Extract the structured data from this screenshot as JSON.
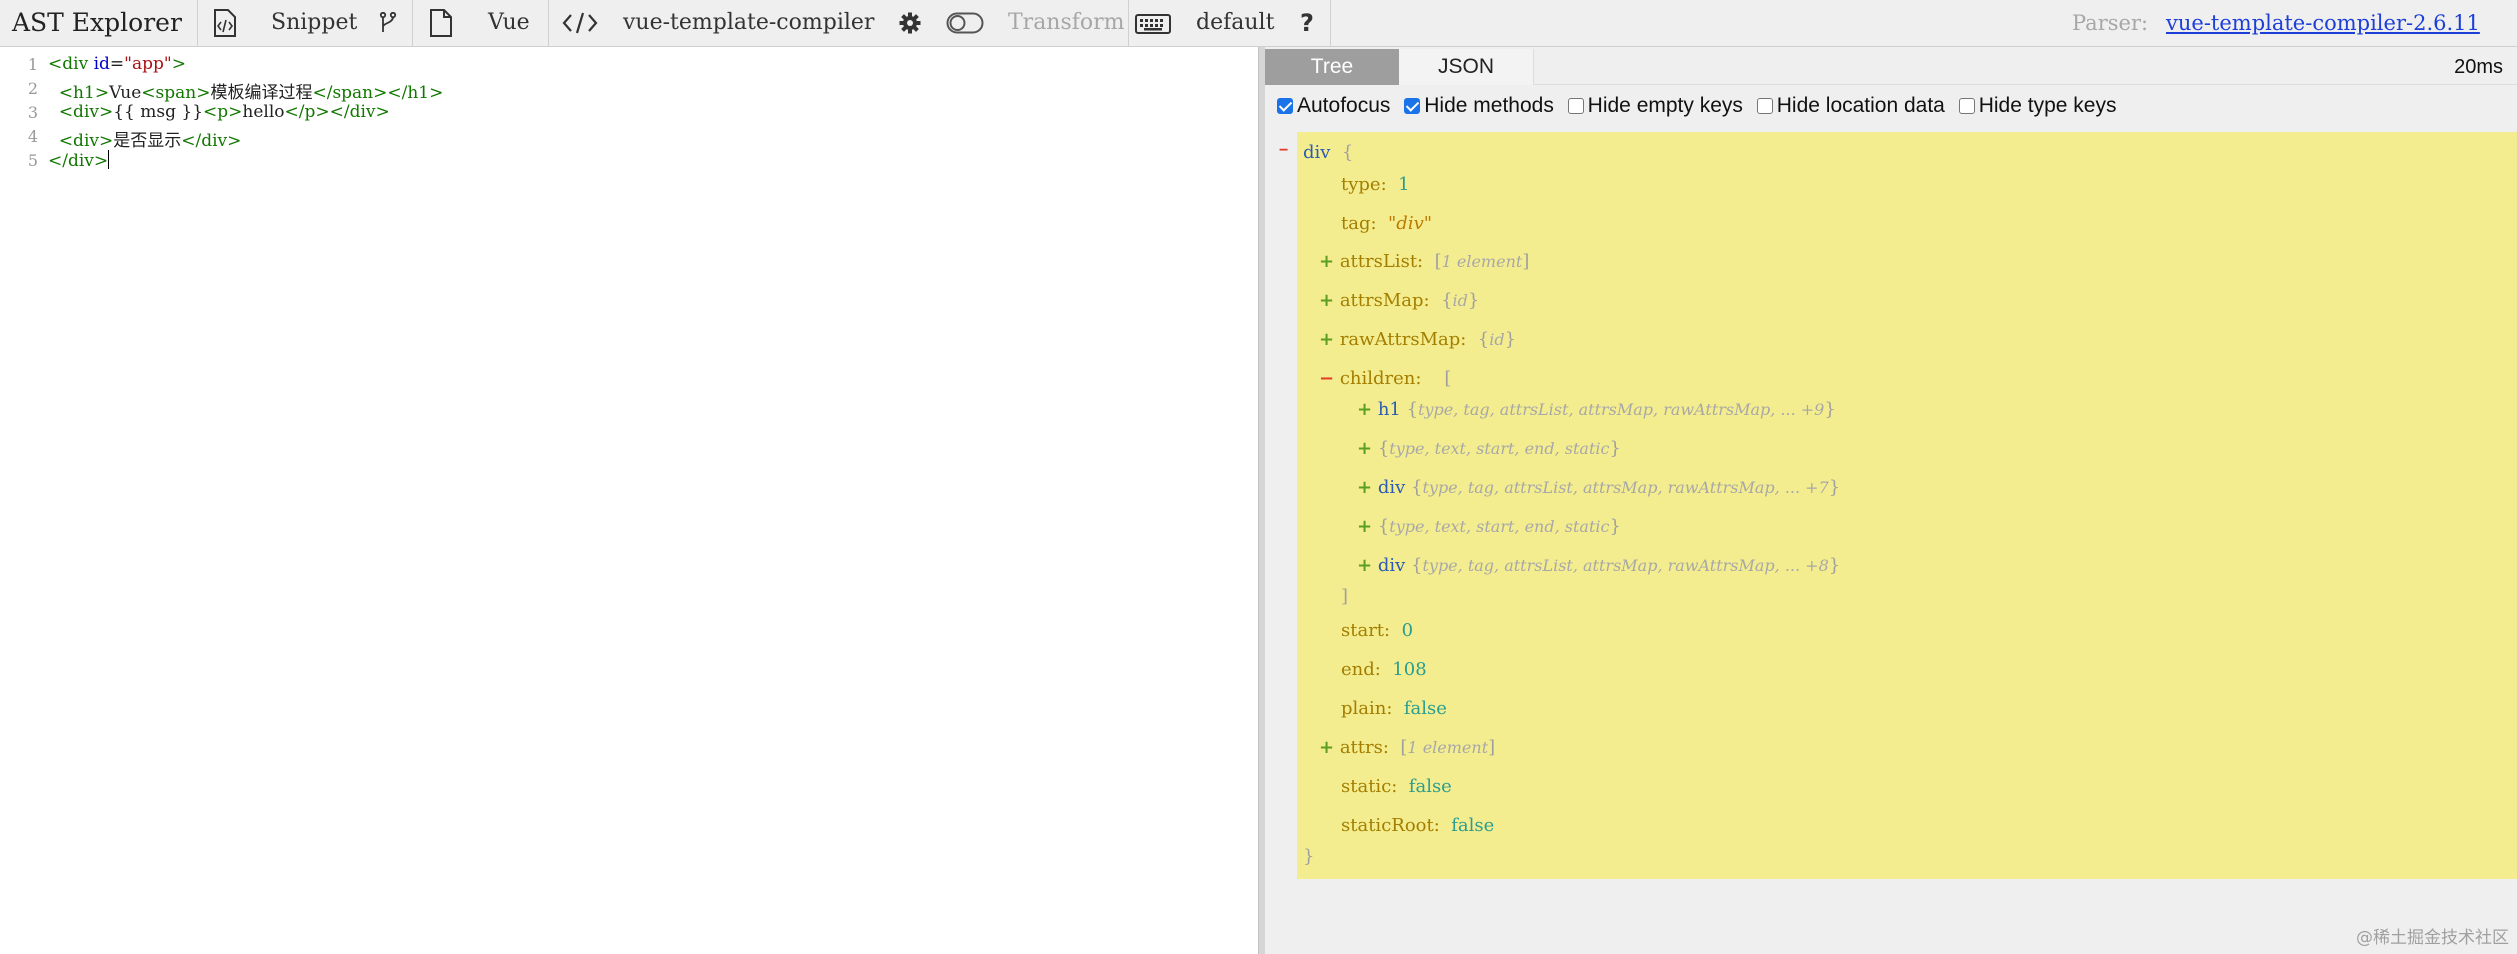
{
  "toolbar": {
    "title": "AST Explorer",
    "snippet": "Snippet",
    "language": "Vue",
    "parser_name": "vue-template-compiler",
    "transform": "Transform",
    "keymap": "default",
    "help": "?",
    "parser_label": "Parser:",
    "parser_link": "vue-template-compiler-2.6.11"
  },
  "editor": {
    "line_numbers": [
      "1",
      "2",
      "3",
      "4",
      "5"
    ]
  },
  "output": {
    "tabs": [
      "Tree",
      "JSON"
    ],
    "time": "20ms",
    "options": [
      {
        "label": "Autofocus",
        "checked": true
      },
      {
        "label": "Hide methods",
        "checked": true
      },
      {
        "label": "Hide empty keys",
        "checked": false
      },
      {
        "label": "Hide location data",
        "checked": false
      },
      {
        "label": "Hide type keys",
        "checked": false
      }
    ]
  },
  "watermark": "@稀土掘金技术社区"
}
